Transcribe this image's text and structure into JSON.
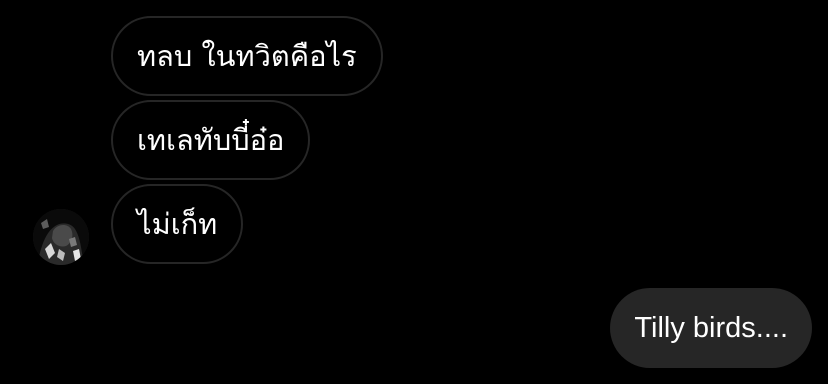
{
  "conversation": {
    "messages": [
      {
        "direction": "received",
        "text": "ทลบ ในทวิตคือไร"
      },
      {
        "direction": "received",
        "text": "เทเลทับบี๋อ๋อ"
      },
      {
        "direction": "received",
        "text": "ไม่เก็ท"
      },
      {
        "direction": "sent",
        "text": "Tilly birds...."
      }
    ],
    "avatar": {
      "icon": "profile-photo-icon"
    }
  },
  "colors": {
    "background": "#000000",
    "received_border": "#262626",
    "sent_bubble": "#262626",
    "text": "#ffffff"
  }
}
